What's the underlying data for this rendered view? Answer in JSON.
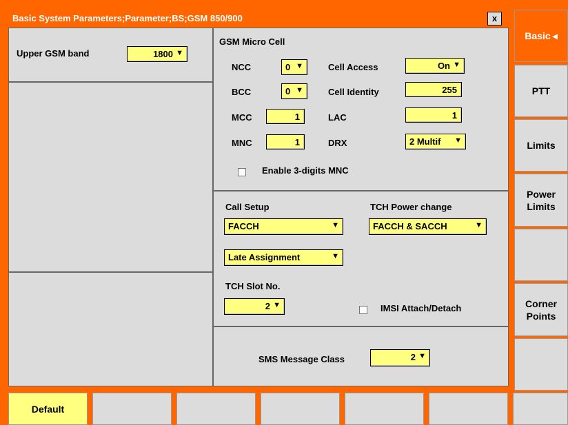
{
  "window": {
    "title": "Basic System Parameters;Parameter;BS;GSM 850/900",
    "close_label": "x"
  },
  "upper_band": {
    "label": "Upper GSM band",
    "value": "1800"
  },
  "micro_cell": {
    "heading": "GSM Micro Cell",
    "ncc_label": "NCC",
    "ncc_value": "0",
    "bcc_label": "BCC",
    "bcc_value": "0",
    "mcc_label": "MCC",
    "mcc_value": "1",
    "mnc_label": "MNC",
    "mnc_value": "1",
    "cell_access_label": "Cell Access",
    "cell_access_value": "On",
    "cell_identity_label": "Cell Identity",
    "cell_identity_value": "255",
    "lac_label": "LAC",
    "lac_value": "1",
    "drx_label": "DRX",
    "drx_value": "2 Multif",
    "enable_mnc_label": "Enable 3-digits MNC"
  },
  "call": {
    "call_setup_label": "Call Setup",
    "call_setup_value": "FACCH",
    "tch_power_label": "TCH Power change",
    "tch_power_value": "FACCH & SACCH",
    "assignment_value": "Late Assignment",
    "tch_slot_label": "TCH Slot No.",
    "tch_slot_value": "2",
    "imsi_label": "IMSI Attach/Detach"
  },
  "sms": {
    "label": "SMS Message Class",
    "value": "2"
  },
  "side_tabs": [
    {
      "label": "Basic"
    },
    {
      "label": "PTT"
    },
    {
      "label": "Limits"
    },
    {
      "label": "Power\nLimits"
    },
    {
      "label": ""
    },
    {
      "label": "Corner\nPoints"
    },
    {
      "label": ""
    }
  ],
  "bottom": {
    "default_label": "Default"
  },
  "icons": {
    "dropdown": "down-arrow-icon",
    "close": "close-icon",
    "side_pointer": "left-chevron-icon"
  },
  "colors": {
    "accent": "#ff6600",
    "field": "#ffff80",
    "panel": "#dcdcdc"
  }
}
